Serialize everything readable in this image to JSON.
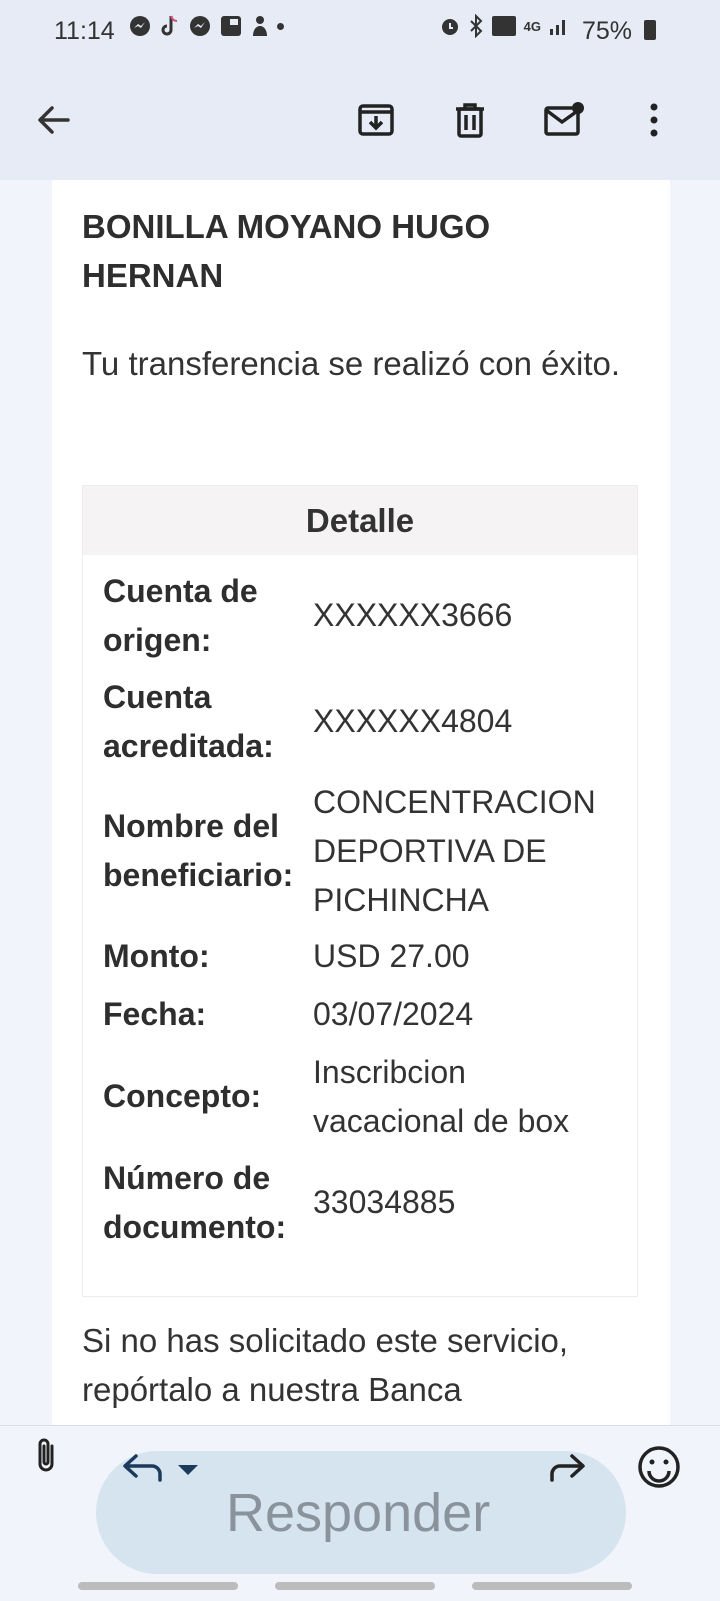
{
  "status_bar": {
    "time": "11:14",
    "battery": "75%",
    "network": "4G"
  },
  "toolbar": {
    "back_label": "←",
    "icons": [
      "archive-icon",
      "delete-icon",
      "mark-unread-icon",
      "more-vert-icon"
    ]
  },
  "email": {
    "sender_name": "BONILLA MOYANO HUGO HERNAN",
    "intro": "Tu transferencia se realizó con éxito.",
    "detail_title": "Detalle",
    "rows": [
      {
        "label": "Cuenta de origen:",
        "value": "XXXXXX3666"
      },
      {
        "label": "Cuenta acreditada:",
        "value": "XXXXXX4804"
      },
      {
        "label": "Nombre del beneficiario:",
        "value": "CONCENTRACION DEPORTIVA DE PICHINCHA"
      },
      {
        "label": "Monto:",
        "value": "USD 27.00"
      },
      {
        "label": "Fecha:",
        "value": "03/07/2024"
      },
      {
        "label": "Concepto:",
        "value": "Inscribcion vacacional de box"
      },
      {
        "label": "Número de documento:",
        "value": "33034885"
      }
    ],
    "footer": "Si no has solicitado este servicio, repórtalo a nuestra Banca"
  },
  "reply_bar": {
    "placeholder": "Responder"
  }
}
